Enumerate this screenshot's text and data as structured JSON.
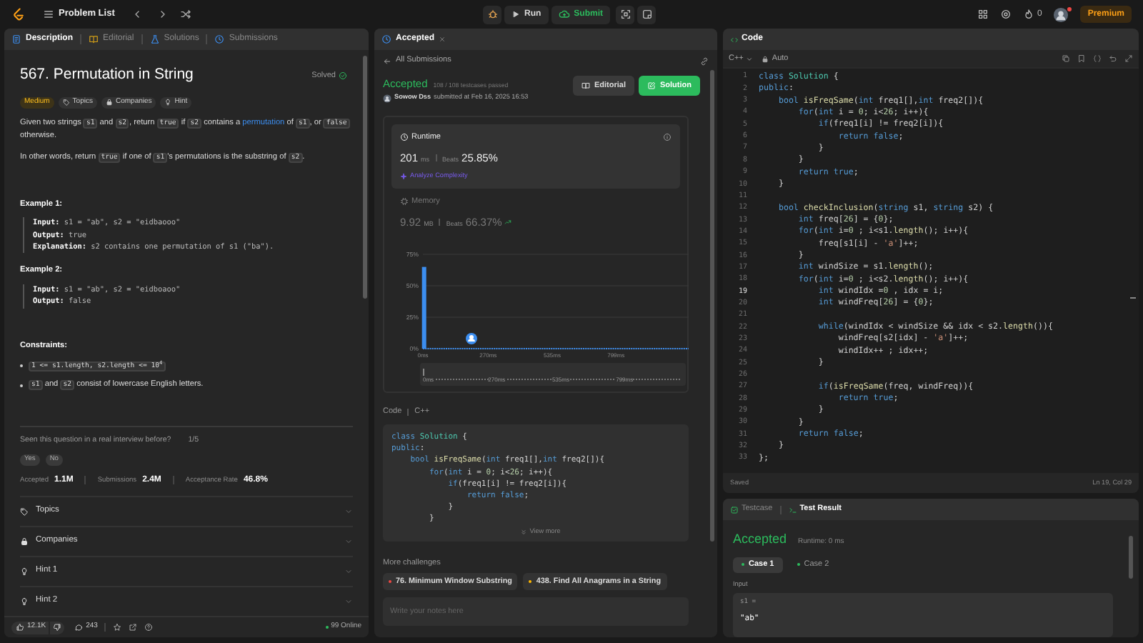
{
  "top_bar": {
    "problem_list": "Problem List",
    "run": "Run",
    "submit": "Submit",
    "streak": "0",
    "premium": "Premium"
  },
  "description_panel": {
    "tabs": [
      {
        "label": "Description",
        "selected": true,
        "kind": "doc"
      },
      {
        "label": "Editorial",
        "selected": false,
        "kind": "book"
      },
      {
        "label": "Solutions",
        "selected": false,
        "kind": "flask"
      },
      {
        "label": "Submissions",
        "selected": false,
        "kind": "clock"
      }
    ],
    "title": "567. Permutation in String",
    "status": "Solved",
    "tags": [
      {
        "label": "Medium",
        "kind": "difficulty"
      },
      {
        "label": "Topics",
        "kind": "tag"
      },
      {
        "label": "Companies",
        "kind": "lock"
      },
      {
        "label": "Hint",
        "kind": "bulb"
      }
    ],
    "paragraphs": [
      [
        {
          "kind": "text",
          "text": "Given two strings "
        },
        {
          "kind": "code",
          "text": "s1"
        },
        {
          "kind": "text",
          "text": " and "
        },
        {
          "kind": "code",
          "text": "s2"
        },
        {
          "kind": "text",
          "text": ", return "
        },
        {
          "kind": "code",
          "text": "true"
        },
        {
          "kind": "text",
          "text": " if "
        },
        {
          "kind": "code",
          "text": "s2"
        },
        {
          "kind": "text",
          "text": " contains a "
        },
        {
          "kind": "link",
          "text": "permutation"
        },
        {
          "kind": "text",
          "text": " of "
        },
        {
          "kind": "code",
          "text": "s1"
        },
        {
          "kind": "text",
          "text": ", or "
        },
        {
          "kind": "code",
          "text": "false"
        },
        {
          "kind": "text",
          "text": " otherwise."
        }
      ],
      [
        {
          "kind": "text",
          "text": "In other words, return "
        },
        {
          "kind": "code",
          "text": "true"
        },
        {
          "kind": "text",
          "text": " if one of "
        },
        {
          "kind": "code",
          "text": "s1"
        },
        {
          "kind": "text",
          "text": "'s permutations is the substring of "
        },
        {
          "kind": "code",
          "text": "s2"
        },
        {
          "kind": "text",
          "text": "."
        }
      ]
    ],
    "examples": [
      {
        "title": "Example 1:",
        "lines": [
          "**Input:** s1 = \"ab\", s2 = \"eidbaooo\"",
          "**Output:** true",
          "**Explanation:** s2 contains one permutation of s1 (\"ba\")."
        ]
      },
      {
        "title": "Example 2:",
        "lines": [
          "**Input:** s1 = \"ab\", s2 = \"eidboaoo\"",
          "**Output:** false"
        ]
      }
    ],
    "constraints_title": "Constraints:",
    "constraints": [
      [
        {
          "kind": "code",
          "text": "1 <= s1.length, s2.length <= 10$^{4}$"
        }
      ],
      [
        {
          "kind": "code",
          "text": "s1"
        },
        {
          "kind": "text",
          "text": " and "
        },
        {
          "kind": "code",
          "text": "s2"
        },
        {
          "kind": "text",
          "text": " consist of lowercase English letters."
        }
      ]
    ],
    "interview": {
      "question": "Seen this question in a real interview before?",
      "count": "1/5",
      "buttons": [
        "Yes",
        "No"
      ]
    },
    "stats": [
      {
        "label": "Accepted",
        "value": "1.1M"
      },
      {
        "label": "Submissions",
        "value": "2.4M"
      },
      {
        "label": "Acceptance Rate",
        "value": "46.8%"
      }
    ],
    "sections": [
      {
        "label": "Topics",
        "kind": "tag"
      },
      {
        "label": "Companies",
        "kind": "lock"
      },
      {
        "label": "Hint 1",
        "kind": "bulb"
      },
      {
        "label": "Hint 2",
        "kind": "bulb"
      }
    ],
    "footer": {
      "likes": "12.1K",
      "comments": "243",
      "online": "99 Online"
    }
  },
  "submission_panel": {
    "tab": "Accepted",
    "back": "All Submissions",
    "status": "Accepted",
    "passed": "108 / 108 testcases passed",
    "author": "Sowow Dss",
    "submitted": "submitted at Feb 16, 2025 16:53",
    "buttons": [
      {
        "label": "Editorial",
        "kind": "editorial"
      },
      {
        "label": "Solution",
        "kind": "solution"
      }
    ],
    "metrics": [
      {
        "title": "Runtime",
        "kind": "runtime",
        "selected": true,
        "value": "201",
        "unit": "ms",
        "beats_label": "Beats",
        "beats": "25.85%",
        "link": "Analyze Complexity"
      },
      {
        "title": "Memory",
        "kind": "memory",
        "selected": false,
        "value": "9.92",
        "unit": "MB",
        "beats_label": "Beats",
        "beats": "66.37%"
      }
    ],
    "chart_data": {
      "type": "bar",
      "x": [
        5
      ],
      "values": [
        65
      ],
      "xlim": [
        0,
        1100
      ],
      "ylim": [
        0,
        75
      ],
      "xticks": [
        {
          "value": 0,
          "label": "0ms"
        },
        {
          "value": 270,
          "label": "270ms"
        },
        {
          "value": 535,
          "label": "535ms"
        },
        {
          "value": 799,
          "label": "799ms"
        }
      ],
      "yticks": [
        {
          "value": 0,
          "label": "0%"
        },
        {
          "value": 25,
          "label": "25%"
        },
        {
          "value": 50,
          "label": "50%"
        },
        {
          "value": 75,
          "label": "75%"
        }
      ]
    },
    "range_slider": {
      "level": 0,
      "labels": [
        "0ms",
        "270ms",
        "535ms",
        "799ms"
      ]
    },
    "code_label": "Code",
    "code_language": "C++",
    "code": [
      [
        {
          "kind": "keyword",
          "text": "class"
        },
        {
          "kind": "type",
          "text": " Solution"
        },
        {
          "kind": "plain",
          "text": " {"
        }
      ],
      [
        {
          "kind": "keyword",
          "text": "public"
        },
        {
          "kind": "plain",
          "text": ":"
        }
      ],
      [
        {
          "kind": "keyword",
          "text": "    bool"
        },
        {
          "kind": "function",
          "text": " isFreqSame"
        },
        {
          "kind": "plain",
          "text": "("
        },
        {
          "kind": "keyword",
          "text": "int"
        },
        {
          "kind": "plain",
          "text": " freq1[],"
        },
        {
          "kind": "keyword",
          "text": "int"
        },
        {
          "kind": "plain",
          "text": " freq2[]){"
        }
      ],
      [
        {
          "kind": "keyword",
          "text": "        for"
        },
        {
          "kind": "plain",
          "text": "("
        },
        {
          "kind": "keyword",
          "text": "int"
        },
        {
          "kind": "plain",
          "text": " i = "
        },
        {
          "kind": "number",
          "text": "0"
        },
        {
          "kind": "plain",
          "text": "; i<"
        },
        {
          "kind": "number",
          "text": "26"
        },
        {
          "kind": "plain",
          "text": "; i++){"
        }
      ],
      [
        {
          "kind": "keyword",
          "text": "            if"
        },
        {
          "kind": "plain",
          "text": "(freq1[i] != freq2[i]){"
        }
      ],
      [
        {
          "kind": "keyword",
          "text": "                return"
        },
        {
          "kind": "keyword",
          "text": " false"
        },
        {
          "kind": "plain",
          "text": ";"
        }
      ],
      [
        {
          "kind": "plain",
          "text": "            }"
        }
      ],
      [
        {
          "kind": "plain",
          "text": "        }"
        }
      ]
    ],
    "view_more": "View more",
    "more_title": "More challenges",
    "challenges": [
      {
        "label": "76. Minimum Window Substring",
        "color": "#ef4743"
      },
      {
        "label": "438. Find All Anagrams in a String",
        "color": "#ffb800"
      }
    ],
    "notes_placeholder": "Write your notes here"
  },
  "code_panel": {
    "title": "Code",
    "language": "C++",
    "mode": "Auto",
    "lines": [
      {
        "number": "1",
        "current": false,
        "tokens": [
          {
            "kind": "keyword",
            "text": "class"
          },
          {
            "kind": "type",
            "text": " Solution"
          },
          {
            "kind": "plain",
            "text": " {"
          }
        ]
      },
      {
        "number": "2",
        "current": false,
        "tokens": [
          {
            "kind": "keyword",
            "text": "public"
          },
          {
            "kind": "plain",
            "text": ":"
          }
        ]
      },
      {
        "number": "3",
        "current": false,
        "tokens": [
          {
            "kind": "keyword",
            "text": "    bool"
          },
          {
            "kind": "function",
            "text": " isFreqSame"
          },
          {
            "kind": "plain",
            "text": "("
          },
          {
            "kind": "keyword",
            "text": "int"
          },
          {
            "kind": "plain",
            "text": " freq1[],"
          },
          {
            "kind": "keyword",
            "text": "int"
          },
          {
            "kind": "plain",
            "text": " freq2[]){"
          }
        ]
      },
      {
        "number": "4",
        "current": false,
        "tokens": [
          {
            "kind": "keyword",
            "text": "        for"
          },
          {
            "kind": "plain",
            "text": "("
          },
          {
            "kind": "keyword",
            "text": "int"
          },
          {
            "kind": "plain",
            "text": " i = "
          },
          {
            "kind": "number",
            "text": "0"
          },
          {
            "kind": "plain",
            "text": "; i<"
          },
          {
            "kind": "number",
            "text": "26"
          },
          {
            "kind": "plain",
            "text": "; i++){"
          }
        ]
      },
      {
        "number": "5",
        "current": false,
        "tokens": [
          {
            "kind": "keyword",
            "text": "            if"
          },
          {
            "kind": "plain",
            "text": "(freq1[i] != freq2[i]){"
          }
        ]
      },
      {
        "number": "6",
        "current": false,
        "tokens": [
          {
            "kind": "keyword",
            "text": "                return"
          },
          {
            "kind": "keyword",
            "text": " false"
          },
          {
            "kind": "plain",
            "text": ";"
          }
        ]
      },
      {
        "number": "7",
        "current": false,
        "tokens": [
          {
            "kind": "plain",
            "text": "            }"
          }
        ]
      },
      {
        "number": "8",
        "current": false,
        "tokens": [
          {
            "kind": "plain",
            "text": "        }"
          }
        ]
      },
      {
        "number": "9",
        "current": false,
        "tokens": [
          {
            "kind": "keyword",
            "text": "        return"
          },
          {
            "kind": "keyword",
            "text": " true"
          },
          {
            "kind": "plain",
            "text": ";"
          }
        ]
      },
      {
        "number": "10",
        "current": false,
        "tokens": [
          {
            "kind": "plain",
            "text": "    }"
          }
        ]
      },
      {
        "number": "11",
        "current": false
      },
      {
        "number": "12",
        "current": false,
        "tokens": [
          {
            "kind": "keyword",
            "text": "    bool"
          },
          {
            "kind": "function",
            "text": " checkInclusion"
          },
          {
            "kind": "plain",
            "text": "("
          },
          {
            "kind": "keyword",
            "text": "string"
          },
          {
            "kind": "plain",
            "text": " s1, "
          },
          {
            "kind": "keyword",
            "text": "string"
          },
          {
            "kind": "plain",
            "text": " s2) {"
          }
        ]
      },
      {
        "number": "13",
        "current": false,
        "tokens": [
          {
            "kind": "keyword",
            "text": "        int"
          },
          {
            "kind": "plain",
            "text": " freq["
          },
          {
            "kind": "number",
            "text": "26"
          },
          {
            "kind": "plain",
            "text": "] = {"
          },
          {
            "kind": "number",
            "text": "0"
          },
          {
            "kind": "plain",
            "text": "};"
          }
        ]
      },
      {
        "number": "14",
        "current": false,
        "tokens": [
          {
            "kind": "keyword",
            "text": "        for"
          },
          {
            "kind": "plain",
            "text": "("
          },
          {
            "kind": "keyword",
            "text": "int"
          },
          {
            "kind": "plain",
            "text": " i="
          },
          {
            "kind": "number",
            "text": "0"
          },
          {
            "kind": "plain",
            "text": " ; i<s1."
          },
          {
            "kind": "function",
            "text": "length"
          },
          {
            "kind": "plain",
            "text": "(); i++){"
          }
        ]
      },
      {
        "number": "15",
        "current": false,
        "tokens": [
          {
            "kind": "plain",
            "text": "            freq[s1[i] - "
          },
          {
            "kind": "string",
            "text": "'a'"
          },
          {
            "kind": "plain",
            "text": "]++;"
          }
        ]
      },
      {
        "number": "16",
        "current": false,
        "tokens": [
          {
            "kind": "plain",
            "text": "        }"
          }
        ]
      },
      {
        "number": "17",
        "current": false,
        "tokens": [
          {
            "kind": "keyword",
            "text": "        int"
          },
          {
            "kind": "plain",
            "text": " windSize = s1."
          },
          {
            "kind": "function",
            "text": "length"
          },
          {
            "kind": "plain",
            "text": "();"
          }
        ]
      },
      {
        "number": "18",
        "current": false,
        "tokens": [
          {
            "kind": "keyword",
            "text": "        for"
          },
          {
            "kind": "plain",
            "text": "("
          },
          {
            "kind": "keyword",
            "text": "int"
          },
          {
            "kind": "plain",
            "text": " i="
          },
          {
            "kind": "number",
            "text": "0"
          },
          {
            "kind": "plain",
            "text": " ; i<s2."
          },
          {
            "kind": "function",
            "text": "length"
          },
          {
            "kind": "plain",
            "text": "(); i++){"
          }
        ]
      },
      {
        "number": "19",
        "current": true,
        "tokens": [
          {
            "kind": "keyword",
            "text": "            int"
          },
          {
            "kind": "plain",
            "text": " windIdx ="
          },
          {
            "kind": "number",
            "text": "0"
          },
          {
            "kind": "plain",
            "text": " , idx = i;"
          }
        ]
      },
      {
        "number": "20",
        "current": false,
        "tokens": [
          {
            "kind": "keyword",
            "text": "            int"
          },
          {
            "kind": "plain",
            "text": " windFreq["
          },
          {
            "kind": "number",
            "text": "26"
          },
          {
            "kind": "plain",
            "text": "] = {"
          },
          {
            "kind": "number",
            "text": "0"
          },
          {
            "kind": "plain",
            "text": "};"
          }
        ]
      },
      {
        "number": "21",
        "current": false
      },
      {
        "number": "22",
        "current": false,
        "tokens": [
          {
            "kind": "keyword",
            "text": "            while"
          },
          {
            "kind": "plain",
            "text": "(windIdx < windSize && idx < s2."
          },
          {
            "kind": "function",
            "text": "length"
          },
          {
            "kind": "plain",
            "text": "()){"
          }
        ]
      },
      {
        "number": "23",
        "current": false,
        "tokens": [
          {
            "kind": "plain",
            "text": "                windFreq[s2[idx] - "
          },
          {
            "kind": "string",
            "text": "'a'"
          },
          {
            "kind": "plain",
            "text": "]++;"
          }
        ]
      },
      {
        "number": "24",
        "current": false,
        "tokens": [
          {
            "kind": "plain",
            "text": "                windIdx++ ; idx++;"
          }
        ]
      },
      {
        "number": "25",
        "current": false,
        "tokens": [
          {
            "kind": "plain",
            "text": "            }"
          }
        ]
      },
      {
        "number": "26",
        "current": false
      },
      {
        "number": "27",
        "current": false,
        "tokens": [
          {
            "kind": "keyword",
            "text": "            if"
          },
          {
            "kind": "plain",
            "text": "("
          },
          {
            "kind": "function",
            "text": "isFreqSame"
          },
          {
            "kind": "plain",
            "text": "(freq, windFreq)){"
          }
        ]
      },
      {
        "number": "28",
        "current": false,
        "tokens": [
          {
            "kind": "keyword",
            "text": "                return"
          },
          {
            "kind": "keyword",
            "text": " true"
          },
          {
            "kind": "plain",
            "text": ";"
          }
        ]
      },
      {
        "number": "29",
        "current": false,
        "tokens": [
          {
            "kind": "plain",
            "text": "            }"
          }
        ]
      },
      {
        "number": "30",
        "current": false,
        "tokens": [
          {
            "kind": "plain",
            "text": "        }"
          }
        ]
      },
      {
        "number": "31",
        "current": false,
        "tokens": [
          {
            "kind": "keyword",
            "text": "        return"
          },
          {
            "kind": "keyword",
            "text": " false"
          },
          {
            "kind": "plain",
            "text": ";"
          }
        ]
      },
      {
        "number": "32",
        "current": false,
        "tokens": [
          {
            "kind": "plain",
            "text": "    }"
          }
        ]
      },
      {
        "number": "33",
        "current": false,
        "tokens": [
          {
            "kind": "plain",
            "text": "};"
          }
        ]
      }
    ],
    "save_state": "Saved",
    "cursor": "Ln 19, Col 29"
  },
  "test_panel": {
    "tabs": [
      {
        "label": "Testcase",
        "selected": false,
        "kind": "testcase"
      },
      {
        "label": "Test Result",
        "selected": true,
        "kind": "result"
      }
    ],
    "result": "Accepted",
    "runtime": "Runtime: 0 ms",
    "cases": [
      {
        "label": "Case 1",
        "selected": true
      },
      {
        "label": "Case 2",
        "selected": false
      }
    ],
    "input_label": "Input",
    "variable": "s1 =",
    "value": "\"ab\""
  }
}
